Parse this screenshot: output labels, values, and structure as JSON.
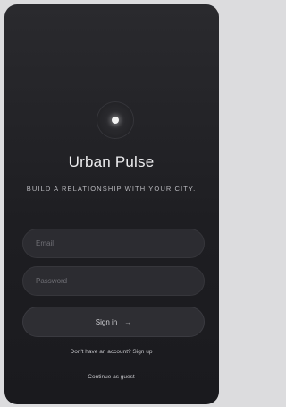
{
  "app": {
    "title": "Urban Pulse",
    "tagline": "BUILD A RELATIONSHIP WITH YOUR CITY."
  },
  "form": {
    "email_placeholder": "Email",
    "password_placeholder": "Password",
    "signin_label": "Sign in",
    "signin_arrow": "→"
  },
  "footer": {
    "signup_text": "Don't have an account? Sign up",
    "guest_text": "Continue as guest"
  },
  "icons": {
    "logo": "glowing-dot-icon",
    "signin": "arrow-right-icon"
  },
  "colors": {
    "background": "#1e1e22",
    "text": "#ececee",
    "field": "#2c2c31"
  }
}
